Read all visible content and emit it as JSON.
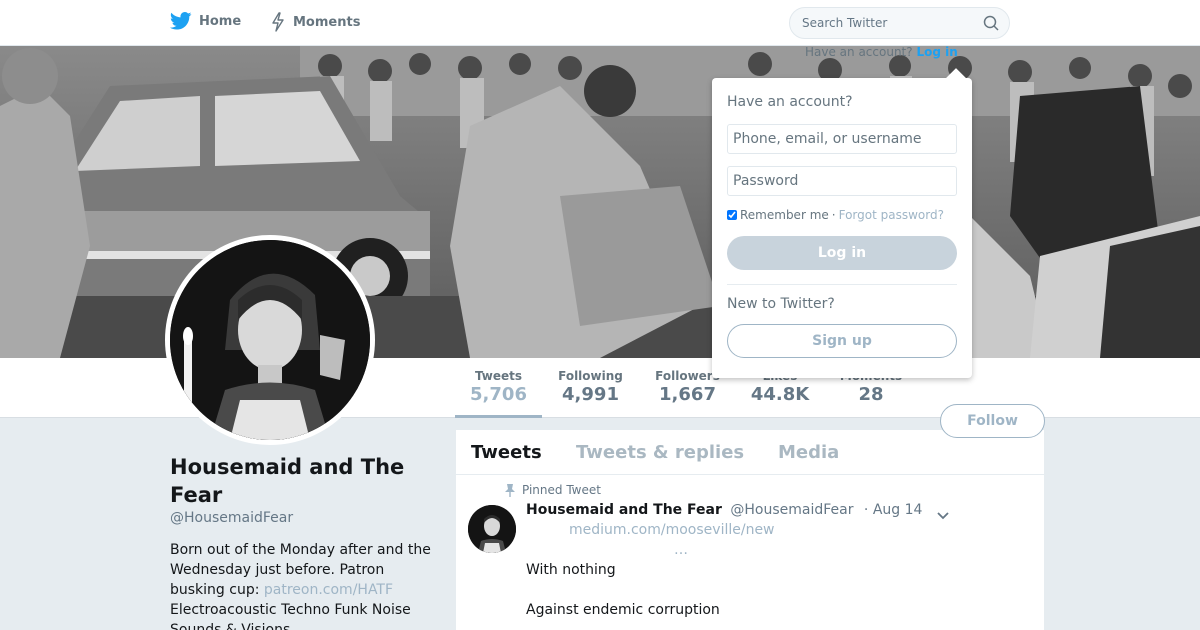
{
  "nav": {
    "home_label": "Home",
    "moments_label": "Moments",
    "search_placeholder": "Search Twitter",
    "have_account_text": "Have an account?",
    "login_link": "Log in"
  },
  "colors": {
    "brand_blue": "#1da1f2",
    "muted_button": "#9fb5c6",
    "page_bg": "#e6ecf0"
  },
  "profile": {
    "name": "Housemaid and The Fear",
    "handle": "@HousemaidFear",
    "bio_text": "Born out of the Monday after and the Wednesday just before. Patron busking cup:",
    "bio_link": "patreon.com/HATF",
    "bio_text_2": "Electroacoustic Techno Funk Noise Sounds & Visions"
  },
  "stats": [
    {
      "label": "Tweets",
      "value": "5,706"
    },
    {
      "label": "Following",
      "value": "4,991"
    },
    {
      "label": "Followers",
      "value": "1,667"
    },
    {
      "label": "Likes",
      "value": "44.8K"
    },
    {
      "label": "Moments",
      "value": "28"
    }
  ],
  "follow_label": "Follow",
  "timeline": {
    "tabs": [
      "Tweets",
      "Tweets & replies",
      "Media"
    ],
    "pinned_label": "Pinned Tweet",
    "tweet": {
      "name": "Housemaid and The Fear",
      "handle": "@HousemaidFear",
      "time": "· Aug 14",
      "link": "medium.com/mooseville/new",
      "ellipsis": "…",
      "line1": "With nothing",
      "line2": "Against endemic corruption"
    }
  },
  "login_panel": {
    "heading": "Have an account?",
    "username_placeholder": "Phone, email, or username",
    "password_placeholder": "Password",
    "remember_label": "Remember me",
    "separator": "·",
    "forgot_label": "Forgot password?",
    "login_button": "Log in",
    "new_heading": "New to Twitter?",
    "signup_button": "Sign up"
  }
}
